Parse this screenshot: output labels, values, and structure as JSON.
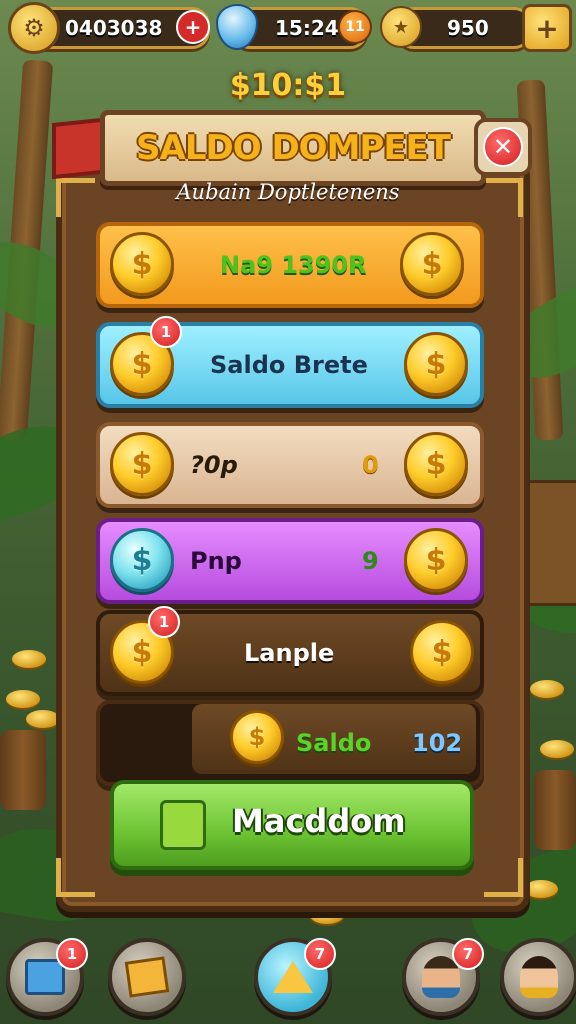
{
  "hud": {
    "coins_value": "0403038",
    "gems_value": "15:24",
    "gems_badge": "11",
    "trophy_value": "950",
    "plus_symbol": "+"
  },
  "top_amount": "$10:$1",
  "dialog": {
    "title": "SALDO DOMPEET",
    "subtitle": "Aubain Doptletenens",
    "close_symbol": "✕",
    "rows": [
      {
        "label": "Na9 1390R",
        "value": "",
        "badge": "",
        "color": "#f7a832"
      },
      {
        "label": "Saldo Brete",
        "value": "",
        "badge": "1",
        "color": "#6fd0ef"
      },
      {
        "label": "?0p",
        "value": "0",
        "badge": "",
        "color": "#e8c8a8"
      },
      {
        "label": "Pnp",
        "value": "9",
        "badge": "",
        "color": "#c86ee8"
      },
      {
        "label": "Lanple",
        "value": "",
        "badge": "1",
        "color": "#5a3a1f"
      },
      {
        "label": "Saldo",
        "value": "102",
        "badge": "",
        "color": "#5a3a1f"
      }
    ],
    "action_label": "Macddom"
  },
  "bottom_nav": [
    {
      "badge": "1"
    },
    {
      "badge": ""
    },
    {
      "badge": "7"
    },
    {
      "badge": "7"
    },
    {
      "badge": ""
    }
  ],
  "colors": {
    "gold": "#ffcc2a",
    "panel_wood": "#6b4423",
    "green_button": "#6cc332",
    "badge_red": "#d41e1e"
  }
}
